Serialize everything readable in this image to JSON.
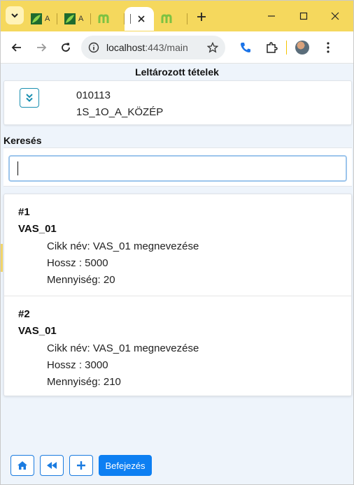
{
  "browser": {
    "tabs": [
      {
        "name": "tab-1",
        "favicon": "leaf-icon",
        "text": "A"
      },
      {
        "name": "tab-2",
        "favicon": "leaf-icon",
        "text": "A"
      },
      {
        "name": "tab-3",
        "favicon": "m-logo-icon",
        "text": ""
      },
      {
        "name": "tab-4-active",
        "favicon": "",
        "text": ""
      },
      {
        "name": "tab-5",
        "favicon": "m-logo-icon",
        "text": ""
      }
    ],
    "address": {
      "host": "localhost",
      "path": ":443/main"
    },
    "colors": {
      "tabstrip": "#f5d85d",
      "accent": "#0d7ff2"
    }
  },
  "page": {
    "title": "Leltározott tételek",
    "location": {
      "code": "010113",
      "name": "1S_1O_A_KÖZÉP"
    },
    "search": {
      "label": "Keresés",
      "value": "",
      "placeholder": ""
    },
    "items": [
      {
        "number": "#1",
        "code": "VAS_01",
        "article": "Cikk név: VAS_01 megnevezése",
        "length": "Hossz : 5000",
        "quantity": "Mennyiség: 20"
      },
      {
        "number": "#2",
        "code": "VAS_01",
        "article": "Cikk név: VAS_01 megnevezése",
        "length": "Hossz : 3000",
        "quantity": "Mennyiség: 210"
      }
    ],
    "footer": {
      "finish_label": "Befejezés"
    }
  }
}
